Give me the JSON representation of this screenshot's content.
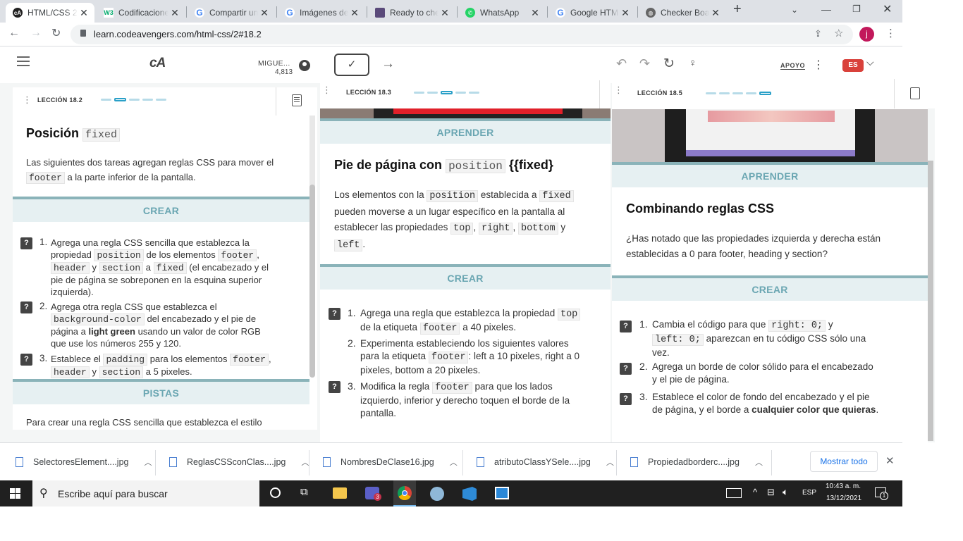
{
  "browser": {
    "tabs": [
      {
        "title": "HTML/CSS 2.",
        "favicon": "codeavengers-icon",
        "active": true
      },
      {
        "title": "Codificacione",
        "favicon": "w3schools-icon"
      },
      {
        "title": "Compartir un",
        "favicon": "google-icon"
      },
      {
        "title": "Imágenes de",
        "favicon": "google-icon"
      },
      {
        "title": "Ready to che",
        "favicon": "shield-icon"
      },
      {
        "title": "WhatsApp",
        "favicon": "whatsapp-icon"
      },
      {
        "title": "Google HTML",
        "favicon": "google-icon"
      },
      {
        "title": "Checker Boar",
        "favicon": "globe-icon"
      }
    ],
    "url": "learn.codeavengers.com/html-css/2#18.2",
    "profile_initial": "j"
  },
  "app_header": {
    "logo": "cA",
    "user_name": "MIGUE...",
    "user_points": "4,813",
    "support_label": "APOYO",
    "language": "ES"
  },
  "panels": [
    {
      "lesson": "LECCIÓN 18.2",
      "title_prefix": "Posición",
      "title_code": "fixed",
      "intro_a": "Las siguientes dos tareas agregan reglas CSS para mover el",
      "intro_code": "footer",
      "intro_b": "a la parte inferior de la pantalla.",
      "create_label": "CREAR",
      "hints_label": "PISTAS",
      "hints_text": "Para crear una regla CSS sencilla que establezca el estilo",
      "tasks": [
        {
          "num": "1.",
          "line1": "Agrega una regla CSS sencilla que establezca la",
          "l2a": "propiedad",
          "l2c": "position",
          "l2b": "de los elementos",
          "l2d": "footer",
          "l2e": ",",
          "l3c1": "header",
          "l3a": "y",
          "l3c2": "section",
          "l3b": "a",
          "l3c3": "fixed",
          "l3d": "(el encabezado y el",
          "line4": "pie de página se sobreponen en la esquina superior",
          "line5": "izquierda)."
        },
        {
          "num": "2.",
          "line1": "Agrega otra regla CSS que establezca el",
          "l2c": "background-color",
          "l2b": "del encabezado y el pie de",
          "l3a": "página a",
          "l3bold": "light green",
          "l3b": "usando un valor de color RGB",
          "line4": "que use los números 255 y 120."
        },
        {
          "num": "3.",
          "l1a": "Establece el",
          "l1c": "padding",
          "l1b": "para los elementos",
          "l1d": "footer",
          "l1e": ",",
          "l2c1": "header",
          "l2a": "y",
          "l2c2": "section",
          "l2b": "a 5 pixeles."
        }
      ]
    },
    {
      "lesson": "LECCIÓN 18.3",
      "learn_label": "APRENDER",
      "title_a": "Pie de página con",
      "title_code": "position",
      "title_b": "{{fixed}",
      "p1a": "Los elementos con la",
      "p1c": "position",
      "p1b": "establecida a",
      "p1d": "fixed",
      "p2": "pueden moverse a un lugar específico en la pantalla al",
      "p3a": "establecer las propiedades",
      "p3c1": "top",
      "p3c2": "right",
      "p3c3": "bottom",
      "p3b": "y",
      "p4c": "left",
      "p4a": ".",
      "create_label": "CREAR",
      "tasks": [
        {
          "num": "1.",
          "l1a": "Agrega una regla que establezca la propiedad",
          "l1c": "top",
          "l2a": "de la etiqueta",
          "l2c": "footer",
          "l2b": "a 40 pixeles."
        },
        {
          "num": "2.",
          "l1": "Experimenta estableciendo los siguientes valores",
          "l2a": "para la etiqueta",
          "l2c": "footer",
          "l2b": ": left a 10 pixeles, right a 0",
          "l3": "pixeles, bottom a 20 pixeles."
        },
        {
          "num": "3.",
          "l1a": "Modifica la regla",
          "l1c": "footer",
          "l1b": "para que los lados",
          "l2": "izquierdo, inferior y derecho toquen el borde de la",
          "l3": "pantalla."
        }
      ]
    },
    {
      "lesson": "LECCIÓN 18.5",
      "learn_label": "APRENDER",
      "title": "Combinando reglas CSS",
      "p1": "¿Has notado que las propiedades izquierda y derecha están",
      "p2": "establecidas a 0 para footer, heading y section?",
      "create_label": "CREAR",
      "tasks": [
        {
          "num": "1.",
          "l1a": "Cambia el código para que",
          "l1c": "right: 0;",
          "l1b": "y",
          "l2c": "left: 0;",
          "l2b": "aparezcan en tu código CSS sólo una",
          "l3": "vez."
        },
        {
          "num": "2.",
          "l1": "Agrega un borde de color sólido para el encabezado",
          "l2": "y el pie de página."
        },
        {
          "num": "3.",
          "l1": "Establece el color de fondo del encabezado y el pie",
          "l2a": "de página, y el borde a",
          "l2bold": "cualquier color que quieras",
          "l2b": "."
        }
      ]
    }
  ],
  "downloads": {
    "files": [
      "SelectoresElement....jpg",
      "ReglasCSSconClas....jpg",
      "NombresDeClase16.jpg",
      "atributoClassYSele....jpg",
      "Propiedadborderc....jpg"
    ],
    "show_all": "Mostrar todo"
  },
  "taskbar": {
    "search_placeholder": "Escribe aquí para buscar",
    "lang": "ESP",
    "time": "10:43 a. m.",
    "date": "13/12/2021",
    "notification_count": "1",
    "teams_badge": "3"
  },
  "colors": {
    "accent": "#2aa0c8",
    "band": "#e6f0f2",
    "band_border": "#8ab3b9",
    "band_text": "#6aa6b2",
    "lang_badge": "#d9413b"
  }
}
